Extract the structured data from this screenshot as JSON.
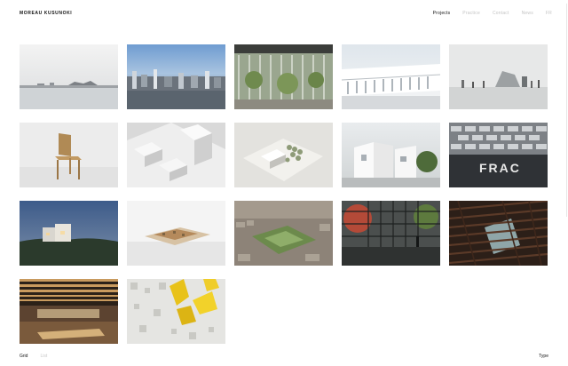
{
  "brand": {
    "name": "MOREAU KUSUNOKI"
  },
  "nav": {
    "items": [
      {
        "label": "Projects",
        "active": true
      },
      {
        "label": "Practice",
        "active": false
      },
      {
        "label": "Contact",
        "active": false
      },
      {
        "label": "News",
        "active": false
      },
      {
        "label": "FR",
        "active": false
      }
    ]
  },
  "projects": {
    "tiles": [
      {
        "name": "project-tile-1",
        "overlay_text": ""
      },
      {
        "name": "project-tile-2",
        "overlay_text": ""
      },
      {
        "name": "project-tile-3",
        "overlay_text": ""
      },
      {
        "name": "project-tile-4",
        "overlay_text": ""
      },
      {
        "name": "project-tile-5",
        "overlay_text": ""
      },
      {
        "name": "project-tile-6",
        "overlay_text": ""
      },
      {
        "name": "project-tile-7",
        "overlay_text": ""
      },
      {
        "name": "project-tile-8",
        "overlay_text": ""
      },
      {
        "name": "project-tile-9",
        "overlay_text": ""
      },
      {
        "name": "project-tile-10",
        "overlay_text": "FRAC"
      },
      {
        "name": "project-tile-11",
        "overlay_text": ""
      },
      {
        "name": "project-tile-12",
        "overlay_text": ""
      },
      {
        "name": "project-tile-13",
        "overlay_text": ""
      },
      {
        "name": "project-tile-14",
        "overlay_text": ""
      },
      {
        "name": "project-tile-15",
        "overlay_text": ""
      },
      {
        "name": "project-tile-16",
        "overlay_text": ""
      },
      {
        "name": "project-tile-17",
        "overlay_text": ""
      }
    ]
  },
  "footer": {
    "view_grid": "Grid",
    "view_list": "List",
    "sort": "Type"
  }
}
